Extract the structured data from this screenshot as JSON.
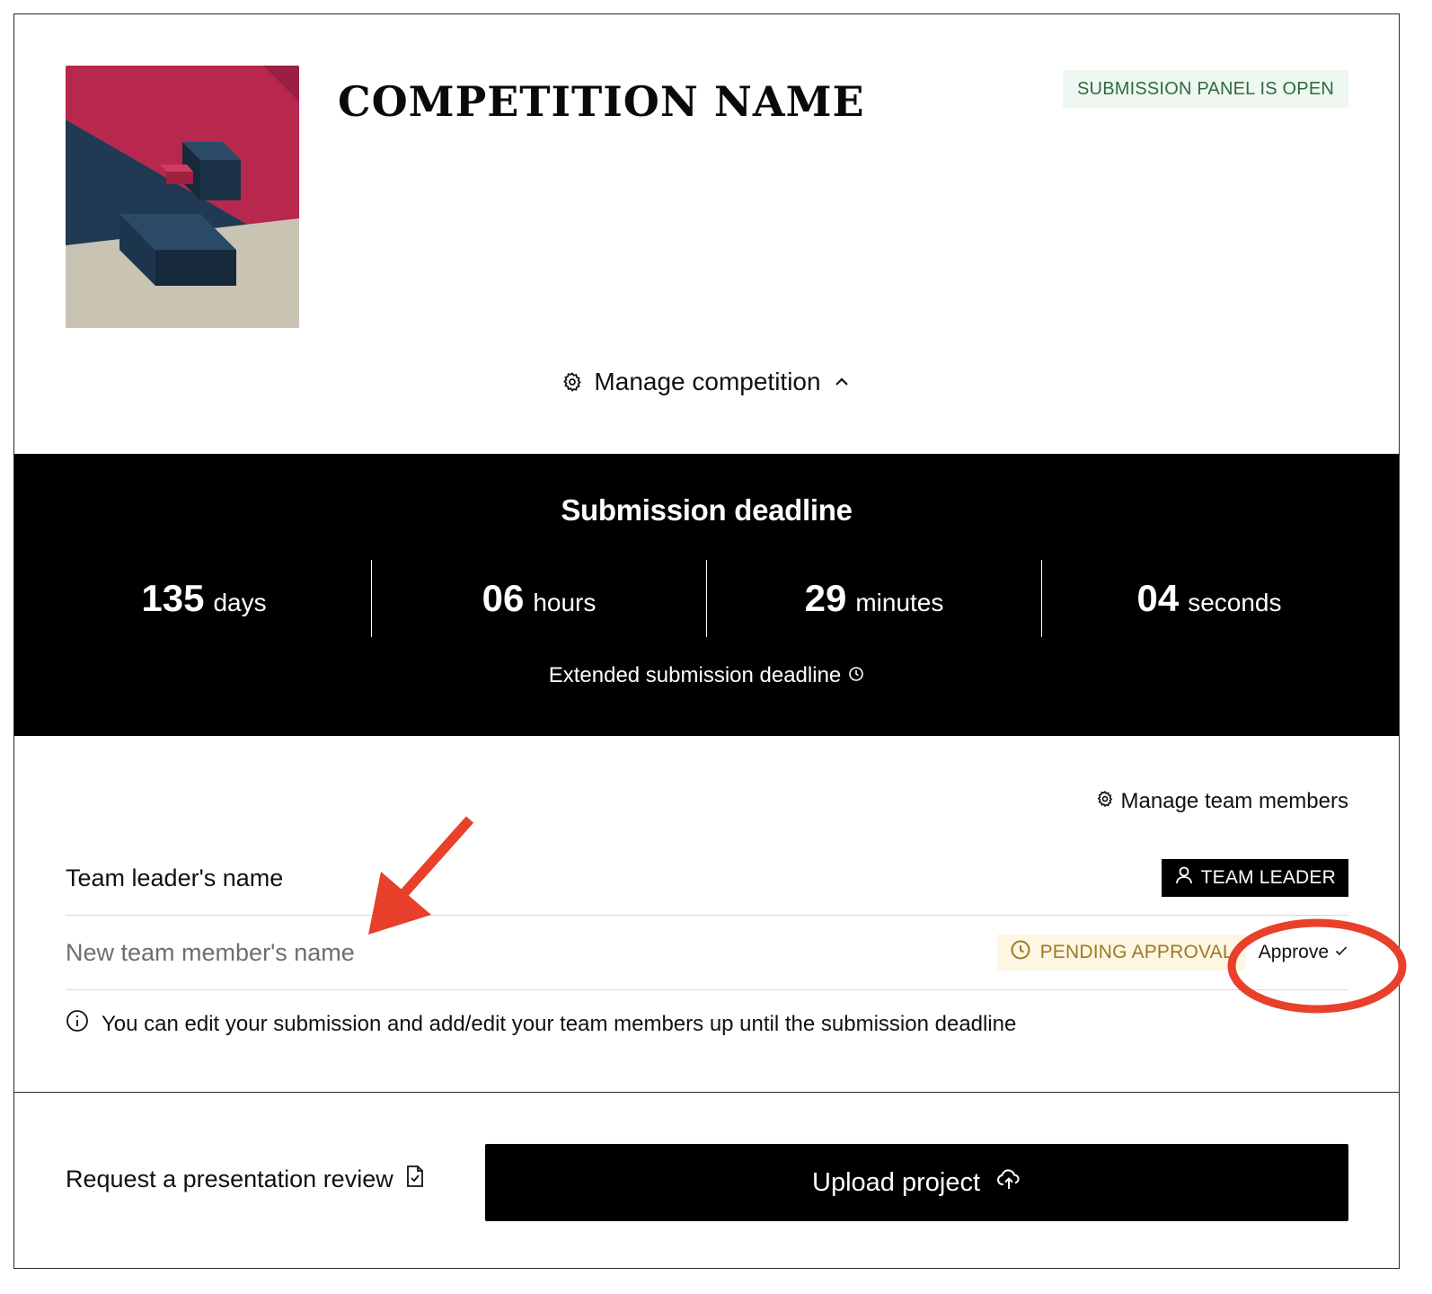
{
  "competition": {
    "title": "COMPETITION NAME",
    "status_label": "SUBMISSION PANEL IS OPEN",
    "manage_label": "Manage competition"
  },
  "deadline": {
    "title": "Submission deadline",
    "counter": [
      {
        "value": "135",
        "unit": "days"
      },
      {
        "value": "06",
        "unit": "hours"
      },
      {
        "value": "29",
        "unit": "minutes"
      },
      {
        "value": "04",
        "unit": "seconds"
      }
    ],
    "extended_label": "Extended submission deadline"
  },
  "team": {
    "manage_label": "Manage team members",
    "leader": {
      "name": "Team leader's name",
      "badge": "TEAM LEADER"
    },
    "member": {
      "name": "New team member's name",
      "badge": "PENDING APPROVAL",
      "approve_label": "Approve"
    },
    "info_text": "You can edit your submission and add/edit your team members up until the submission deadline"
  },
  "footer": {
    "review_label": "Request a presentation review",
    "upload_label": "Upload project"
  },
  "colors": {
    "status_bg": "#eef7f0",
    "status_text": "#2e6b41",
    "pending_bg": "#fdf6e3",
    "pending_text": "#9b7a22",
    "annotation": "#e8402a",
    "cover_pink": "#b8274e",
    "cover_navy": "#1f3a52",
    "cover_beige": "#c9c3b3"
  },
  "icons": {
    "manage_competition": "gear-icon",
    "manage_chevron": "chevron-up-icon",
    "extended": "clock-icon",
    "manage_team": "gear-icon",
    "leader_badge": "user-icon",
    "pending": "clock-icon",
    "approve": "check-icon",
    "info": "info-icon",
    "review": "document-check-icon",
    "upload": "cloud-upload-icon"
  }
}
